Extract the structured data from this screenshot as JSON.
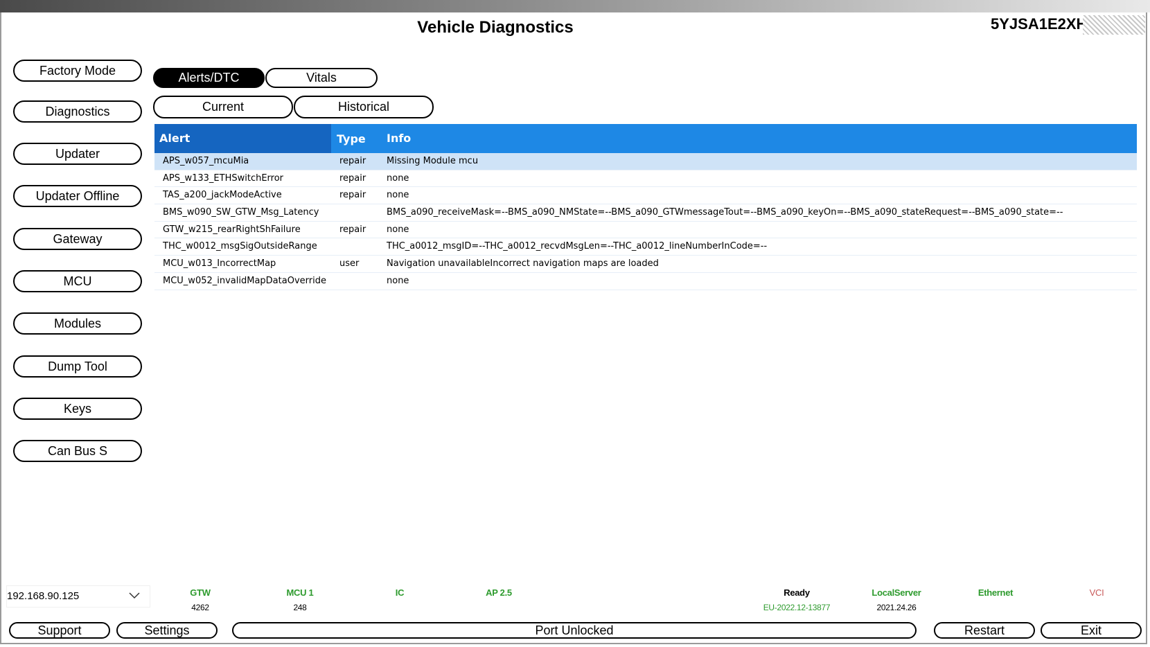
{
  "header": {
    "title": "Vehicle Diagnostics",
    "vin": "5YJSA1E2XH"
  },
  "sidebar": {
    "items": [
      {
        "label": "Factory Mode"
      },
      {
        "label": "Diagnostics"
      },
      {
        "label": "Updater"
      },
      {
        "label": "Updater Offline"
      },
      {
        "label": "Gateway"
      },
      {
        "label": "MCU"
      },
      {
        "label": "Modules"
      },
      {
        "label": "Dump Tool"
      },
      {
        "label": "Keys"
      },
      {
        "label": "Can Bus S"
      }
    ]
  },
  "tabs": {
    "primary": [
      "Alerts/DTC",
      "Vitals"
    ],
    "active": "Alerts/DTC",
    "secondary": [
      "Current",
      "Historical"
    ]
  },
  "table": {
    "headers": {
      "alert": "Alert",
      "type": "Type",
      "info": "Info"
    },
    "rows": [
      {
        "alert": "APS_w057_mcuMia",
        "type": "repair",
        "info": "Missing Module  mcu"
      },
      {
        "alert": "APS_w133_ETHSwitchError",
        "type": "repair",
        "info": "none"
      },
      {
        "alert": "TAS_a200_jackModeActive",
        "type": "repair",
        "info": "none"
      },
      {
        "alert": "BMS_w090_SW_GTW_Msg_Latency",
        "type": "",
        "info": "BMS_a090_receiveMask=--BMS_a090_NMState=--BMS_a090_GTWmessageTout=--BMS_a090_keyOn=--BMS_a090_stateRequest=--BMS_a090_state=--"
      },
      {
        "alert": "GTW_w215_rearRightShFailure",
        "type": "repair",
        "info": "none"
      },
      {
        "alert": "THC_w0012_msgSigOutsideRange",
        "type": "",
        "info": "THC_a0012_msgID=--THC_a0012_recvdMsgLen=--THC_a0012_lineNumberInCode=--"
      },
      {
        "alert": "MCU_w013_IncorrectMap",
        "type": "user",
        "info": "Navigation unavailableIncorrect navigation maps are loaded"
      },
      {
        "alert": "MCU_w052_invalidMapDataOverride",
        "type": "",
        "info": "none"
      }
    ]
  },
  "footer": {
    "ip": "192.168.90.125",
    "status": {
      "gtw_label": "GTW",
      "gtw_value": "4262",
      "mcu_label": "MCU 1",
      "mcu_value": "248",
      "ic_label": "IC",
      "ap_label": "AP 2.5",
      "ready_label": "Ready",
      "ready_value": "EU-2022.12-13877",
      "local_label": "LocalServer",
      "local_value": "2021.24.26",
      "eth_label": "Ethernet",
      "vci_label": "VCI"
    },
    "buttons": {
      "support": "Support",
      "settings": "Settings",
      "port": "Port Unlocked",
      "restart": "Restart",
      "exit": "Exit"
    }
  },
  "colors": {
    "table_header": "#1e88e5",
    "table_header_alert": "#1565c0",
    "selected_row": "#cfe3f7",
    "status_green": "#2e9b2e",
    "status_vci": "#c85a5a"
  }
}
